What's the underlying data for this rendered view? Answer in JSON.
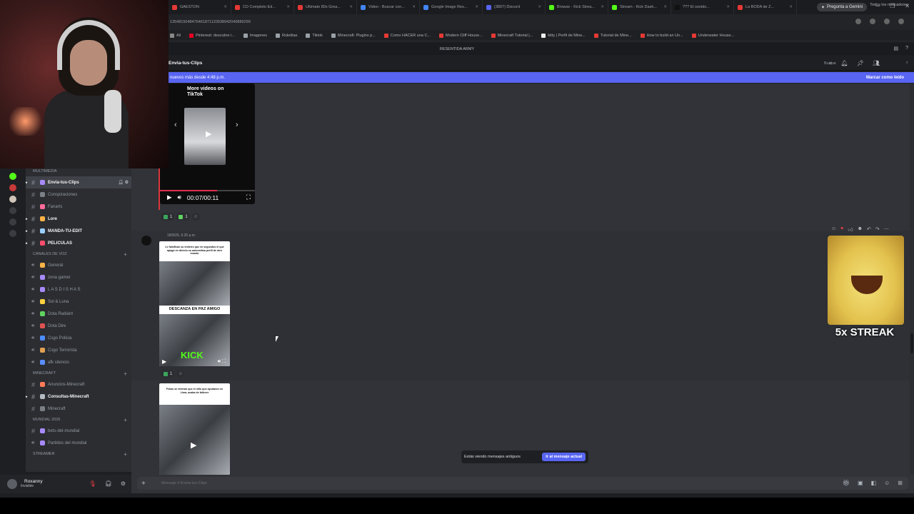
{
  "browser": {
    "tabs": [
      {
        "label": "GAESTON",
        "color": "#e53935"
      },
      {
        "label": "CD Completo Ed...",
        "color": "#e53935"
      },
      {
        "label": "Ultimate 80s Grea...",
        "color": "#e53935"
      },
      {
        "label": "Video - Buscar con...",
        "color": "#4285f4"
      },
      {
        "label": "Google Image Res...",
        "color": "#4285f4"
      },
      {
        "label": "(3807) Discord",
        "color": "#5865f2"
      },
      {
        "label": "Browse - Kick Strea...",
        "color": "#53fc18"
      },
      {
        "label": "Stream - Kick Dash...",
        "color": "#53fc18"
      },
      {
        "label": "??? El sonido...",
        "color": "#111111"
      },
      {
        "label": "La BODA de Z...",
        "color": "#e53935"
      }
    ],
    "gemini_label": "Pregunta a Gemini",
    "url": "1354815048476461871133938942040889299",
    "bookmarks": [
      {
        "label": "Ali",
        "color": "#888888"
      },
      {
        "label": "Pinterest: descubre i...",
        "color": "#e60023"
      },
      {
        "label": "Imagenes",
        "color": "#9aa0a6"
      },
      {
        "label": "Ruletitas",
        "color": "#9aa0a6"
      },
      {
        "label": "Tiktok",
        "color": "#9aa0a6"
      },
      {
        "label": "Minecraft: Plugins p...",
        "color": "#9aa0a6"
      },
      {
        "label": "Como HACER una C...",
        "color": "#e53935"
      },
      {
        "label": "Modern Cliff House...",
        "color": "#e53935"
      },
      {
        "label": "Minecraft Tutorial |...",
        "color": "#e53935"
      },
      {
        "label": "kitty | Perfil de Mine...",
        "color": "#eeeeee"
      },
      {
        "label": "Tutorial de Mine...",
        "color": "#e53935"
      },
      {
        "label": "How to build an Un...",
        "color": "#e53935"
      },
      {
        "label": "Underwater House...",
        "color": "#e53935"
      }
    ],
    "all_bookmarks": "Todos los marcadores"
  },
  "server_name": "RESENTIDA ARMY",
  "channel": {
    "name": "Envia-tus-Clips",
    "search_placeholder": "Buscar",
    "new_messages": "nuevos más desde 4:48 p.m.",
    "mark_read": "Marcar como leído"
  },
  "sidebar": {
    "categories": [
      {
        "name": "MULTIMEDIA",
        "channels": [
          {
            "label": "Envia-tus-Clips",
            "type": "text",
            "active": true,
            "color": "#a78bfa"
          },
          {
            "label": "Conspiraciones",
            "type": "text",
            "color": "#7b7f86"
          },
          {
            "label": "Fanarts",
            "type": "text",
            "color": "#ff6b9b"
          },
          {
            "label": "Lore",
            "type": "text",
            "bold": true,
            "color": "#ffb347"
          },
          {
            "label": "MANDA-TU-EDIT",
            "type": "text",
            "bold": true,
            "color": "#9ad0ff"
          },
          {
            "label": "PELICULAS",
            "type": "text",
            "bold": true,
            "color": "#ff4d6d"
          }
        ]
      },
      {
        "name": "CANALES DE VOZ",
        "channels": [
          {
            "label": "General",
            "type": "voice",
            "color": "#ffb347"
          },
          {
            "label": "zona gamer",
            "type": "voice",
            "color": "#a78bfa"
          },
          {
            "label": "L A S D I S H A S",
            "type": "voice",
            "color": "#a78bfa"
          },
          {
            "label": "Sol & Luna",
            "type": "voice",
            "color": "#ffd23f"
          },
          {
            "label": "Dota Radiant",
            "type": "voice",
            "color": "#5fd35f"
          },
          {
            "label": "Dota Dire",
            "type": "voice",
            "color": "#e05252"
          },
          {
            "label": "Csgo Policia",
            "type": "voice",
            "color": "#4d8dff"
          },
          {
            "label": "Csgo Terrorista",
            "type": "voice",
            "color": "#e0a052"
          },
          {
            "label": "afk silencio",
            "type": "voice",
            "color": "#5a8dff"
          }
        ]
      },
      {
        "name": "MINECRAFT",
        "channels": [
          {
            "label": "Anuncios-Minecraft",
            "type": "text",
            "color": "#ff7a59"
          },
          {
            "label": "Consultas-Minecraft",
            "type": "text",
            "bold": true,
            "color": "#b5bac1"
          },
          {
            "label": "Minecraft",
            "type": "text",
            "color": "#7b7f86"
          }
        ]
      },
      {
        "name": "MUNDIAL 2026",
        "channels": [
          {
            "label": "bets-del-mundial",
            "type": "text",
            "color": "#a78bfa"
          },
          {
            "label": "Partidos del mundial",
            "type": "voice",
            "color": "#a78bfa"
          }
        ]
      },
      {
        "name": "STREAMER",
        "channels": []
      }
    ]
  },
  "user": {
    "name": "Roxanny",
    "status": "Invisible"
  },
  "messages": {
    "video1": {
      "tiktok_text": "TikTok",
      "time": "00:07/00:11",
      "progress": 0.6
    },
    "reactions1": [
      {
        "emoji": "check",
        "color": "#3ba55d",
        "count": "1"
      },
      {
        "emoji": "people",
        "color": "#5fd35f",
        "count": "1"
      }
    ],
    "timestamp2": "18/8/26, 6:26 p.m.",
    "clip2": {
      "caption": "Le falsifican su entierro que en segundos el que apagó en directo su autoestima perfil de otro mundo",
      "rip": "DESCANZA EN PAZ AMIGO",
      "brand": "KICK"
    },
    "reactions2": [
      {
        "emoji": "check",
        "color": "#3ba55d",
        "count": "1"
      }
    ],
    "clip3": {
      "caption": "Fekas se enteran que el niño que ayudaron en Lima, acaba de fallecer"
    },
    "streak": "5x STREAK"
  },
  "old_messages": {
    "text": "Estás viendo mensajes antiguos",
    "button": "Ir al mensaje actual"
  },
  "composer": {
    "placeholder": "Mensaje # Envia-tus-Clips"
  }
}
